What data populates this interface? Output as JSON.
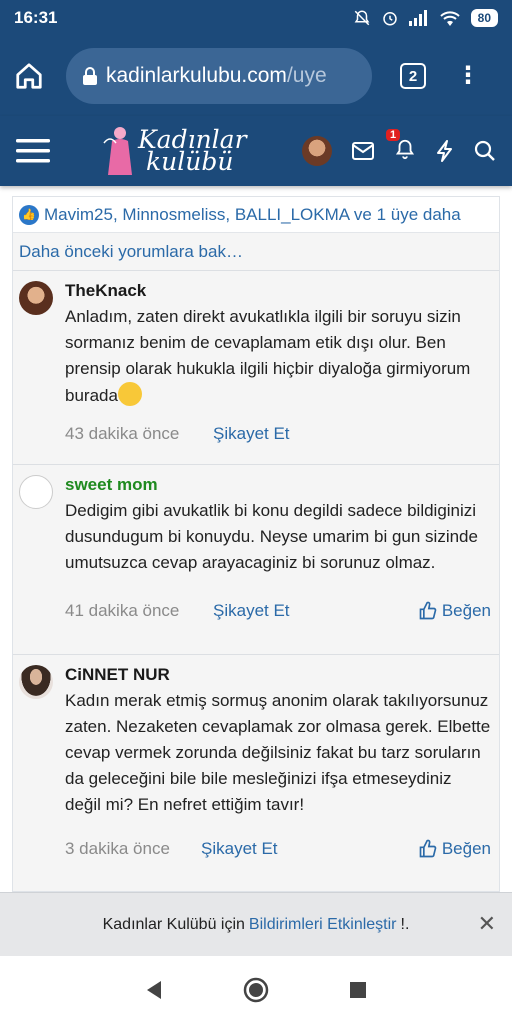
{
  "status_bar": {
    "time": "16:31",
    "battery": "80"
  },
  "browser": {
    "url_main": "kadinlarkulubu.com",
    "url_rest": "/uye",
    "tab_count": "2"
  },
  "site": {
    "logo_line1": "Kadınlar",
    "logo_line2": "kulübü",
    "notification_count": "1"
  },
  "likes": {
    "text": "Mavim25, Minnosmeliss, BALLI_LOKMA ve 1 üye daha"
  },
  "earlier_link": "Daha önceki yorumlara bak…",
  "comments": [
    {
      "author": "TheKnack",
      "body": "Anladım, zaten direkt avukatlıkla ilgili bir soruyu sizin sormanız benim de cevaplamam etik dışı olur. Ben prensip olarak hukukla ilgili hiçbir diyaloğa girmiyorum burada",
      "time": "43 dakika önce",
      "report": "Şikayet Et"
    },
    {
      "author": "sweet mom",
      "body": "Dedigim gibi avukatlik bi konu degildi sadece bildiginizi dusundugum bi konuydu. Neyse umarim bi gun sizinde umutsuzca cevap arayacaginiz bi sorunuz olmaz.",
      "time": "41 dakika önce",
      "report": "Şikayet Et",
      "like": "Beğen"
    },
    {
      "author": "CiNNET NUR",
      "body": "Kadın merak etmiş sormuş anonim olarak takılıyorsunuz zaten. Nezaketen cevaplamak zor olmasa gerek. Elbette cevap vermek zorunda değilsiniz fakat bu tarz soruların da geleceğini bile bile mesleğinizi ifşa etmeseydiniz değil mi? En nefret ettiğim tavır!",
      "time": "3 dakika önce",
      "report": "Şikayet Et",
      "like": "Beğen"
    }
  ],
  "notification_banner": {
    "prefix": "Kadınlar Kulübü için",
    "link": "Bildirimleri Etkinleştir",
    "suffix": "!."
  },
  "colors": {
    "header_bg": "#1c4a7a",
    "link": "#2b6aa8",
    "green_author": "#1f8a1f"
  }
}
